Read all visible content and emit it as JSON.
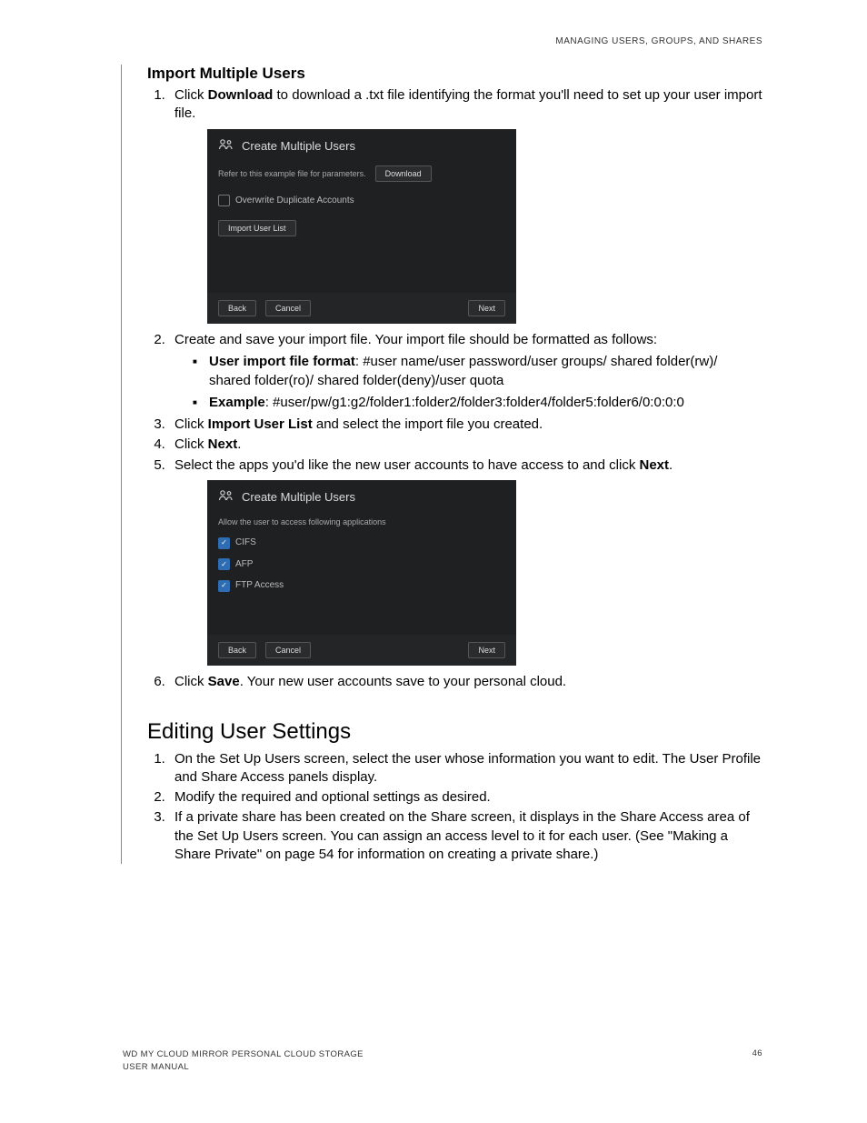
{
  "running_head": "MANAGING USERS, GROUPS, AND SHARES",
  "import": {
    "title": "Import Multiple Users",
    "step1_pre": "Click ",
    "step1_bold": "Download",
    "step1_post": " to download a .txt file identifying the format you'll need to set up your user import file.",
    "step2_lead": "Create and save your import file. Your import file should be formatted as follows:",
    "bullet1_bold": "User import file format",
    "bullet1_rest": ": #user name/user password/user groups/ shared folder(rw)/ shared folder(ro)/ shared folder(deny)/user quota",
    "bullet2_bold": "Example",
    "bullet2_rest": ": #user/pw/g1:g2/folder1:folder2/folder3:folder4/folder5:folder6/0:0:0:0",
    "step3_pre": "Click ",
    "step3_bold": "Import User List",
    "step3_post": " and select the import file you created.",
    "step4_pre": "Click ",
    "step4_bold": "Next",
    "step4_post": ".",
    "step5_pre": "Select the apps you'd like the new user accounts to have access to and click ",
    "step5_bold": "Next",
    "step5_post": ".",
    "step6_pre": "Click ",
    "step6_bold": "Save",
    "step6_post": ". Your new user accounts save to your personal cloud."
  },
  "dialog1": {
    "title": "Create Multiple Users",
    "param_text": "Refer to this example file for parameters.",
    "download": "Download",
    "overwrite": "Overwrite Duplicate Accounts",
    "import_list": "Import User List",
    "back": "Back",
    "cancel": "Cancel",
    "next": "Next"
  },
  "dialog2": {
    "title": "Create Multiple Users",
    "desc": "Allow the user to access following applications",
    "app1": "CIFS",
    "app2": "AFP",
    "app3": "FTP Access",
    "back": "Back",
    "cancel": "Cancel",
    "next": "Next"
  },
  "edit": {
    "heading": "Editing User Settings",
    "step1": "On the Set Up Users screen, select the user whose information you want to edit. The User Profile and Share Access panels display.",
    "step2": "Modify the required and optional settings as desired.",
    "step3": "If a private share has been created on the Share screen, it displays in the Share Access area of the Set Up Users screen. You can assign an access level to it for each user. (See \"Making a Share Private\" on page 54 for information on creating a private share.)"
  },
  "footer": {
    "product": "WD MY CLOUD MIRROR PERSONAL CLOUD STORAGE",
    "doc": "USER MANUAL",
    "page": "46"
  }
}
